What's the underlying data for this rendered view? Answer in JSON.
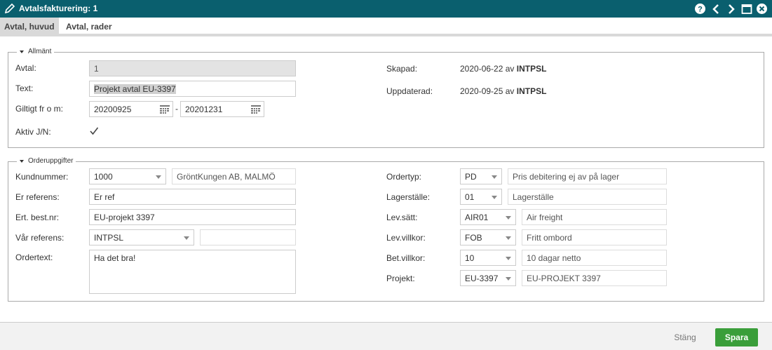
{
  "window": {
    "title": "Avtalsfakturering: 1"
  },
  "tabs": [
    {
      "label": "Avtal, huvud"
    },
    {
      "label": "Avtal, rader"
    }
  ],
  "general": {
    "legend": "Allmänt",
    "avtal_label": "Avtal:",
    "avtal_value": "1",
    "text_label": "Text:",
    "text_value": "Projekt avtal EU-3397",
    "valid_label": "Giltigt fr o m:",
    "valid_from": "20200925",
    "valid_sep": "-",
    "valid_to": "20201231",
    "active_label": "Aktiv J/N:",
    "active_checked": true,
    "created_label": "Skapad:",
    "created_date": "2020-06-22 av",
    "created_user": "INTPSL",
    "updated_label": "Uppdaterad:",
    "updated_date": "2020-09-25 av",
    "updated_user": "INTPSL"
  },
  "order": {
    "legend": "Orderuppgifter",
    "customer_label": "Kundnummer:",
    "customer_value": "1000",
    "customer_name": "GröntKungen AB, MALMÖ",
    "their_ref_label": "Er referens:",
    "their_ref_value": "Er ref",
    "their_order_label": "Ert. best.nr:",
    "their_order_value": "EU-projekt 3397",
    "our_ref_label": "Vår referens:",
    "our_ref_value": "INTPSL",
    "our_ref_desc": "",
    "ordertext_label": "Ordertext:",
    "ordertext_value": "Ha det bra!",
    "ordertype_label": "Ordertyp:",
    "ordertype_value": "PD",
    "ordertype_desc": "Pris debitering ej av på lager",
    "warehouse_label": "Lagerställe:",
    "warehouse_value": "01",
    "warehouse_desc": "Lagerställe",
    "delivery_label": "Lev.sätt:",
    "delivery_value": "AIR01",
    "delivery_desc": "Air freight",
    "terms_label": "Lev.villkor:",
    "terms_value": "FOB",
    "terms_desc": "Fritt ombord",
    "payment_label": "Bet.villkor:",
    "payment_value": "10",
    "payment_desc": "10 dagar netto",
    "project_label": "Projekt:",
    "project_value": "EU-3397",
    "project_desc": "EU-PROJEKT 3397"
  },
  "footer": {
    "close_label": "Stäng",
    "save_label": "Spara"
  },
  "colors": {
    "titlebar": "#0a5f6e",
    "save": "#3a9e3a"
  }
}
